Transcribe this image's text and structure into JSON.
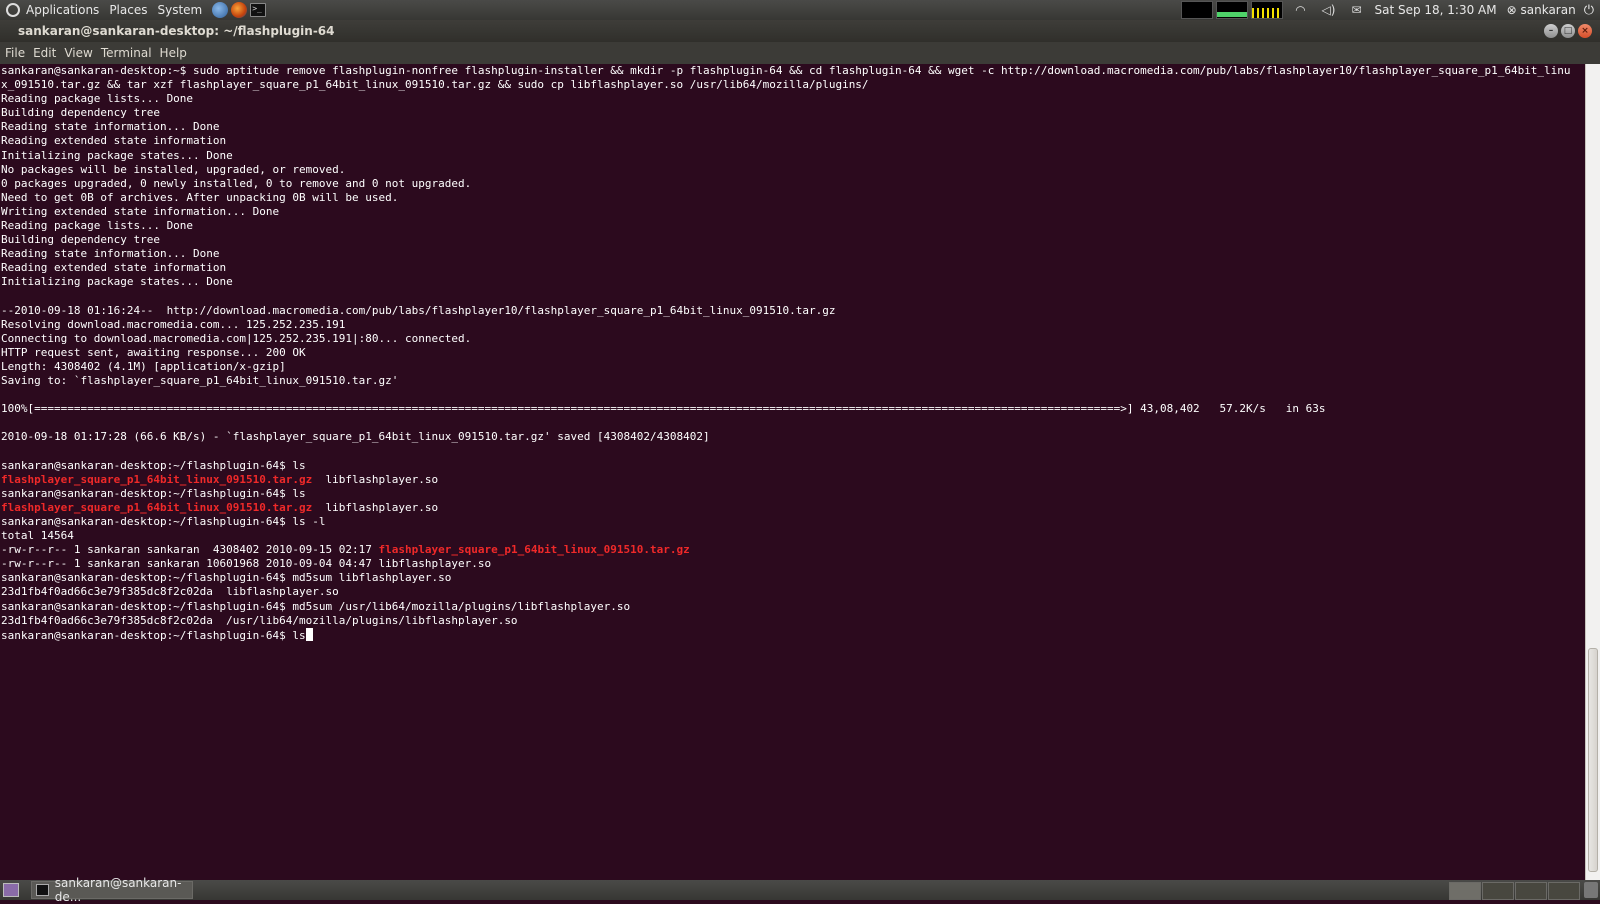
{
  "top_panel": {
    "menus": [
      "Applications",
      "Places",
      "System"
    ],
    "clock": "Sat Sep 18,  1:30 AM",
    "user": "sankaran",
    "icons": {
      "logo": "ubuntu-logo-icon",
      "help": "help-icon",
      "browser": "firefox-icon",
      "terminal": "terminal-icon",
      "wifi": "wifi-icon",
      "volume": "volume-icon",
      "mail": "mail-icon",
      "power": "power-icon"
    }
  },
  "window": {
    "title": "sankaran@sankaran-desktop: ~/flashplugin-64",
    "menubar": [
      "File",
      "Edit",
      "View",
      "Terminal",
      "Help"
    ]
  },
  "terminal": {
    "lines": [
      "sankaran@sankaran-desktop:~$ sudo aptitude remove flashplugin-nonfree flashplugin-installer && mkdir -p flashplugin-64 && cd flashplugin-64 && wget -c http://download.macromedia.com/pub/labs/flashplayer10/flashplayer_square_p1_64bit_linu",
      "x_091510.tar.gz && tar xzf flashplayer_square_p1_64bit_linux_091510.tar.gz && sudo cp libflashplayer.so /usr/lib64/mozilla/plugins/",
      "Reading package lists... Done",
      "Building dependency tree",
      "Reading state information... Done",
      "Reading extended state information",
      "Initializing package states... Done",
      "No packages will be installed, upgraded, or removed.",
      "0 packages upgraded, 0 newly installed, 0 to remove and 0 not upgraded.",
      "Need to get 0B of archives. After unpacking 0B will be used.",
      "Writing extended state information... Done",
      "Reading package lists... Done",
      "Building dependency tree",
      "Reading state information... Done",
      "Reading extended state information",
      "Initializing package states... Done",
      "",
      "--2010-09-18 01:16:24--  http://download.macromedia.com/pub/labs/flashplayer10/flashplayer_square_p1_64bit_linux_091510.tar.gz",
      "Resolving download.macromedia.com... 125.252.235.191",
      "Connecting to download.macromedia.com|125.252.235.191|:80... connected.",
      "HTTP request sent, awaiting response... 200 OK",
      "Length: 4308402 (4.1M) [application/x-gzip]",
      "Saving to: `flashplayer_square_p1_64bit_linux_091510.tar.gz'",
      "",
      "100%[====================================================================================================================================================================>] 43,08,402   57.2K/s   in 63s",
      "",
      "2010-09-18 01:17:28 (66.6 KB/s) - `flashplayer_square_p1_64bit_linux_091510.tar.gz' saved [4308402/4308402]",
      ""
    ],
    "ls_prompt": "sankaran@sankaran-desktop:~/flashplugin-64$ ls",
    "archive_name": "flashplayer_square_p1_64bit_linux_091510.tar.gz",
    "lib_name": "  libflashplayer.so",
    "lsl_prompt": "sankaran@sankaran-desktop:~/flashplugin-64$ ls -l",
    "total": "total 14564",
    "lsl_row1_prefix": "-rw-r--r-- 1 sankaran sankaran  4308402 2010-09-15 02:17 ",
    "lsl_row2": "-rw-r--r-- 1 sankaran sankaran 10601968 2010-09-04 04:47 libflashplayer.so",
    "md5_cmd1": "sankaran@sankaran-desktop:~/flashplugin-64$ md5sum libflashplayer.so",
    "md5_out1": "23d1fb4f0ad66c3e79f385dc8f2c02da  libflashplayer.so",
    "md5_cmd2": "sankaran@sankaran-desktop:~/flashplugin-64$ md5sum /usr/lib64/mozilla/plugins/libflashplayer.so",
    "md5_out2": "23d1fb4f0ad66c3e79f385dc8f2c02da  /usr/lib64/mozilla/plugins/libflashplayer.so",
    "current_prompt": "sankaran@sankaran-desktop:~/flashplugin-64$ ls"
  },
  "bottom_panel": {
    "task_label": "sankaran@sankaran-de...",
    "icons": {
      "show_desktop": "show-desktop-icon",
      "task": "terminal-icon",
      "trash": "trash-icon"
    }
  }
}
